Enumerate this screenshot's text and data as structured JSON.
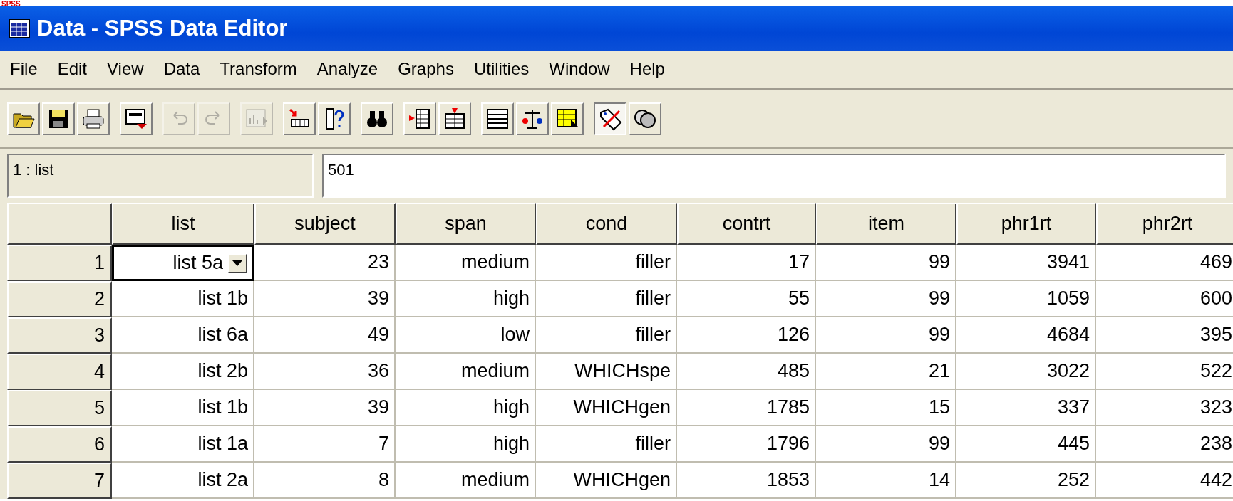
{
  "window": {
    "title": "Data - SPSS Data Editor",
    "logo_text": "SPSS"
  },
  "menu": [
    "File",
    "Edit",
    "View",
    "Data",
    "Transform",
    "Analyze",
    "Graphs",
    "Utilities",
    "Window",
    "Help"
  ],
  "toolbar": [
    [
      {
        "kind": "open",
        "disabled": false,
        "pressed": false
      },
      {
        "kind": "save",
        "disabled": false,
        "pressed": false
      },
      {
        "kind": "print",
        "disabled": false,
        "pressed": false
      }
    ],
    [
      {
        "kind": "dialog",
        "disabled": false,
        "pressed": false
      }
    ],
    [
      {
        "kind": "undo",
        "disabled": true,
        "pressed": false
      },
      {
        "kind": "redo",
        "disabled": true,
        "pressed": false
      }
    ],
    [
      {
        "kind": "chart",
        "disabled": true,
        "pressed": false
      }
    ],
    [
      {
        "kind": "goto",
        "disabled": false,
        "pressed": false
      },
      {
        "kind": "variables",
        "disabled": false,
        "pressed": false
      }
    ],
    [
      {
        "kind": "find",
        "disabled": false,
        "pressed": false
      }
    ],
    [
      {
        "kind": "insertcase",
        "disabled": false,
        "pressed": false
      },
      {
        "kind": "insertvar",
        "disabled": false,
        "pressed": false
      }
    ],
    [
      {
        "kind": "split",
        "disabled": false,
        "pressed": false
      },
      {
        "kind": "weight",
        "disabled": false,
        "pressed": false
      },
      {
        "kind": "select",
        "disabled": false,
        "pressed": false
      }
    ],
    [
      {
        "kind": "labels",
        "disabled": false,
        "pressed": true
      },
      {
        "kind": "sets",
        "disabled": false,
        "pressed": false
      }
    ]
  ],
  "cell_editor": {
    "reference": "1 : list",
    "value": "501"
  },
  "table": {
    "columns": [
      "list",
      "subject",
      "span",
      "cond",
      "contrt",
      "item",
      "phr1rt",
      "phr2rt"
    ],
    "rows": [
      {
        "number": "1",
        "cells": [
          {
            "v": "list 5a",
            "selected": true
          },
          {
            "v": "23",
            "selected": false
          },
          {
            "v": "medium",
            "selected": false
          },
          {
            "v": "filler",
            "selected": false
          },
          {
            "v": "17",
            "selected": false
          },
          {
            "v": "99",
            "selected": false
          },
          {
            "v": "3941",
            "selected": false
          },
          {
            "v": "469",
            "selected": false
          }
        ]
      },
      {
        "number": "2",
        "cells": [
          {
            "v": "list 1b",
            "selected": false
          },
          {
            "v": "39",
            "selected": false
          },
          {
            "v": "high",
            "selected": false
          },
          {
            "v": "filler",
            "selected": false
          },
          {
            "v": "55",
            "selected": false
          },
          {
            "v": "99",
            "selected": false
          },
          {
            "v": "1059",
            "selected": false
          },
          {
            "v": "600",
            "selected": false
          }
        ]
      },
      {
        "number": "3",
        "cells": [
          {
            "v": "list 6a",
            "selected": false
          },
          {
            "v": "49",
            "selected": false
          },
          {
            "v": "low",
            "selected": false
          },
          {
            "v": "filler",
            "selected": false
          },
          {
            "v": "126",
            "selected": false
          },
          {
            "v": "99",
            "selected": false
          },
          {
            "v": "4684",
            "selected": false
          },
          {
            "v": "395",
            "selected": false
          }
        ]
      },
      {
        "number": "4",
        "cells": [
          {
            "v": "list 2b",
            "selected": false
          },
          {
            "v": "36",
            "selected": false
          },
          {
            "v": "medium",
            "selected": false
          },
          {
            "v": "WHICHspe",
            "selected": false
          },
          {
            "v": "485",
            "selected": false
          },
          {
            "v": "21",
            "selected": false
          },
          {
            "v": "3022",
            "selected": false
          },
          {
            "v": "522",
            "selected": false
          }
        ]
      },
      {
        "number": "5",
        "cells": [
          {
            "v": "list 1b",
            "selected": false
          },
          {
            "v": "39",
            "selected": false
          },
          {
            "v": "high",
            "selected": false
          },
          {
            "v": "WHICHgen",
            "selected": false
          },
          {
            "v": "1785",
            "selected": false
          },
          {
            "v": "15",
            "selected": false
          },
          {
            "v": "337",
            "selected": false
          },
          {
            "v": "323",
            "selected": false
          }
        ]
      },
      {
        "number": "6",
        "cells": [
          {
            "v": "list 1a",
            "selected": false
          },
          {
            "v": "7",
            "selected": false
          },
          {
            "v": "high",
            "selected": false
          },
          {
            "v": "filler",
            "selected": false
          },
          {
            "v": "1796",
            "selected": false
          },
          {
            "v": "99",
            "selected": false
          },
          {
            "v": "445",
            "selected": false
          },
          {
            "v": "238",
            "selected": false
          }
        ]
      },
      {
        "number": "7",
        "cells": [
          {
            "v": "list 2a",
            "selected": false
          },
          {
            "v": "8",
            "selected": false
          },
          {
            "v": "medium",
            "selected": false
          },
          {
            "v": "WHICHgen",
            "selected": false
          },
          {
            "v": "1853",
            "selected": false
          },
          {
            "v": "14",
            "selected": false
          },
          {
            "v": "252",
            "selected": false
          },
          {
            "v": "442",
            "selected": false
          }
        ]
      }
    ]
  }
}
